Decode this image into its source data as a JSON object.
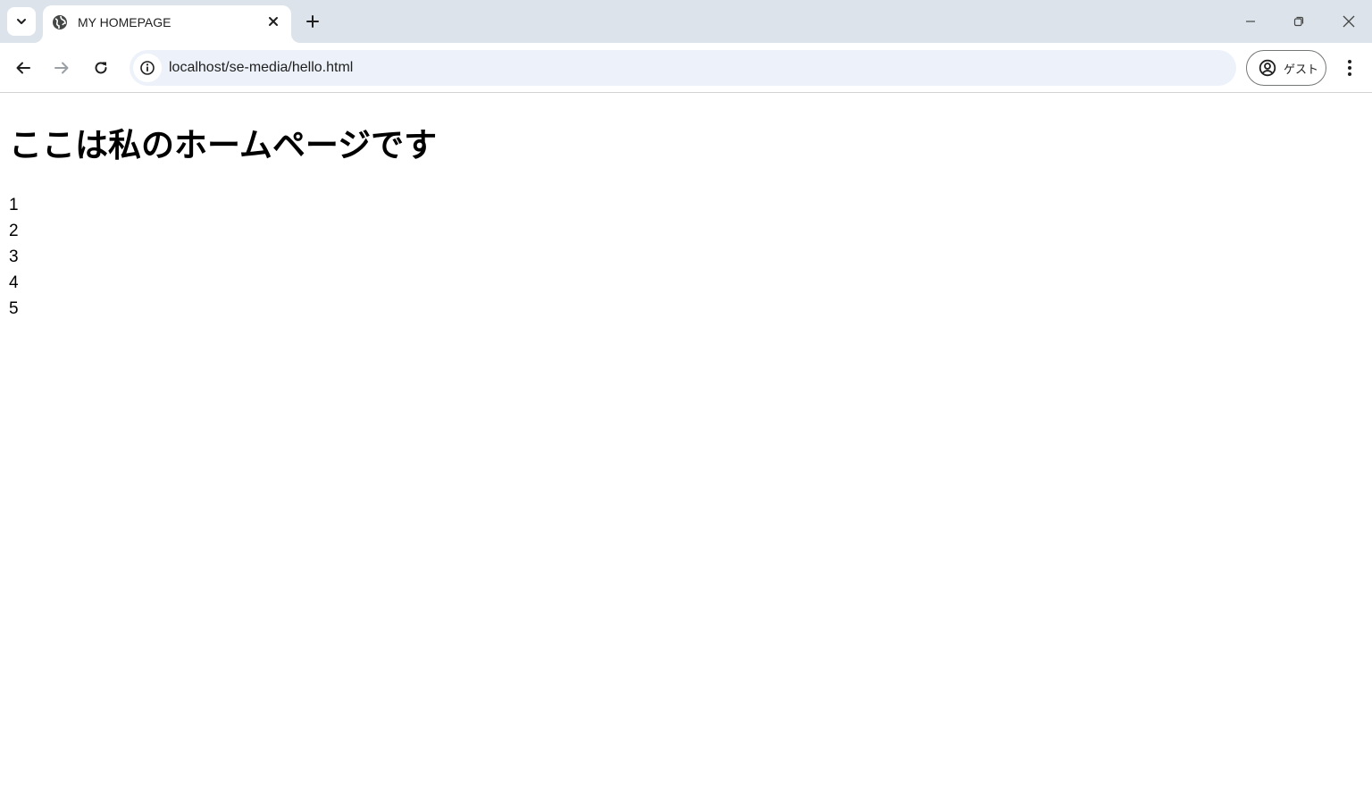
{
  "tab": {
    "title": "MY HOMEPAGE"
  },
  "address_bar": {
    "url": "localhost/se-media/hello.html"
  },
  "profile": {
    "label": "ゲスト"
  },
  "page": {
    "heading": "ここは私のホームページです",
    "lines": [
      "1",
      "2",
      "3",
      "4",
      "5"
    ]
  },
  "icons": {
    "tab_search": "chevron-down-icon",
    "favicon": "globe-icon",
    "tab_close": "close-icon",
    "new_tab": "plus-icon",
    "minimize": "minimize-icon",
    "restore": "restore-icon",
    "close_window": "close-icon",
    "back": "arrow-left-icon",
    "forward": "arrow-right-icon",
    "reload": "reload-icon",
    "site_info": "info-icon",
    "profile": "account-circle-icon",
    "menu": "more-vert-icon"
  },
  "colors": {
    "tabstrip_bg": "#dde3ea",
    "omnibox_bg": "#edf2fa",
    "text": "#1f1f1f"
  }
}
